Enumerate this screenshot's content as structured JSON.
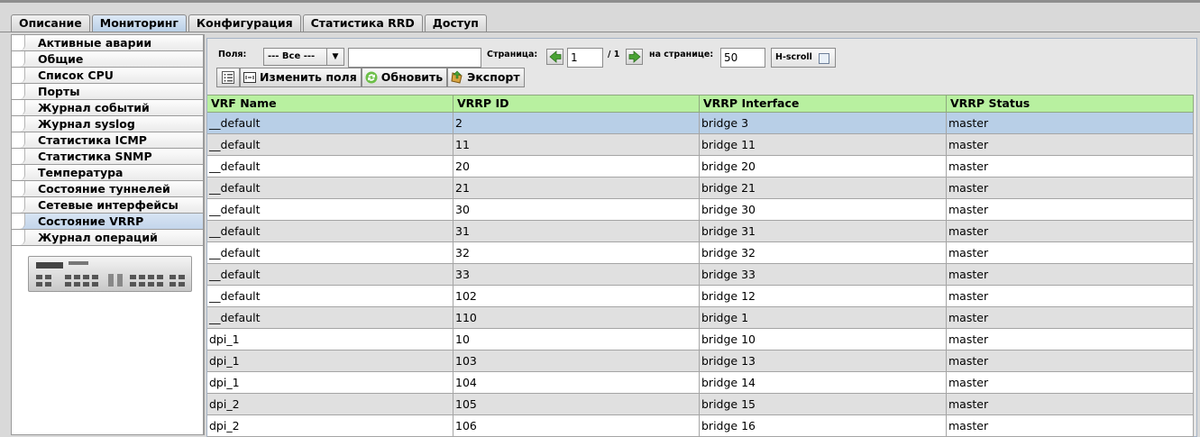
{
  "tabs": [
    {
      "label": "Описание",
      "active": false
    },
    {
      "label": "Мониторинг",
      "active": true
    },
    {
      "label": "Конфигурация",
      "active": false
    },
    {
      "label": "Статистика RRD",
      "active": false
    },
    {
      "label": "Доступ",
      "active": false
    }
  ],
  "sidebar": {
    "items": [
      {
        "label": "Активные аварии"
      },
      {
        "label": "Общие"
      },
      {
        "label": "Список CPU"
      },
      {
        "label": "Порты"
      },
      {
        "label": "Журнал событий"
      },
      {
        "label": "Журнал syslog"
      },
      {
        "label": "Статистика ICMP"
      },
      {
        "label": "Статистика SNMP"
      },
      {
        "label": "Температура"
      },
      {
        "label": "Состояние туннелей"
      },
      {
        "label": "Сетевые интерфейсы"
      },
      {
        "label": "Состояние VRRP",
        "selected": true
      },
      {
        "label": "Журнал операций"
      }
    ]
  },
  "toolbar": {
    "fields_label": "Поля:",
    "fields_value": "--- Все ---",
    "filter_value": "",
    "page_label": "Страница:",
    "page_value": "1",
    "page_total": "/ 1",
    "per_page_label": "на странице:",
    "per_page_value": "50",
    "hscroll_label": "H-scroll",
    "edit_fields_label": "Изменить поля",
    "refresh_label": "Обновить",
    "export_label": "Экспорт"
  },
  "table": {
    "columns": [
      "VRF Name",
      "VRRP ID",
      "VRRP Interface",
      "VRRP Status"
    ],
    "rows": [
      [
        "__default",
        "2",
        "bridge 3",
        "master"
      ],
      [
        "__default",
        "11",
        "bridge 11",
        "master"
      ],
      [
        "__default",
        "20",
        "bridge 20",
        "master"
      ],
      [
        "__default",
        "21",
        "bridge 21",
        "master"
      ],
      [
        "__default",
        "30",
        "bridge 30",
        "master"
      ],
      [
        "__default",
        "31",
        "bridge 31",
        "master"
      ],
      [
        "__default",
        "32",
        "bridge 32",
        "master"
      ],
      [
        "__default",
        "33",
        "bridge 33",
        "master"
      ],
      [
        "__default",
        "102",
        "bridge 12",
        "master"
      ],
      [
        "__default",
        "110",
        "bridge 1",
        "master"
      ],
      [
        "dpi_1",
        "10",
        "bridge 10",
        "master"
      ],
      [
        "dpi_1",
        "103",
        "bridge 13",
        "master"
      ],
      [
        "dpi_1",
        "104",
        "bridge 14",
        "master"
      ],
      [
        "dpi_2",
        "105",
        "bridge 15",
        "master"
      ],
      [
        "dpi_2",
        "106",
        "bridge 16",
        "master"
      ]
    ],
    "selected_row": 0
  },
  "colors": {
    "header_green": "#b8f0a0",
    "selected_blue": "#b8cfe7",
    "row_alt": "#e0e0e0"
  }
}
